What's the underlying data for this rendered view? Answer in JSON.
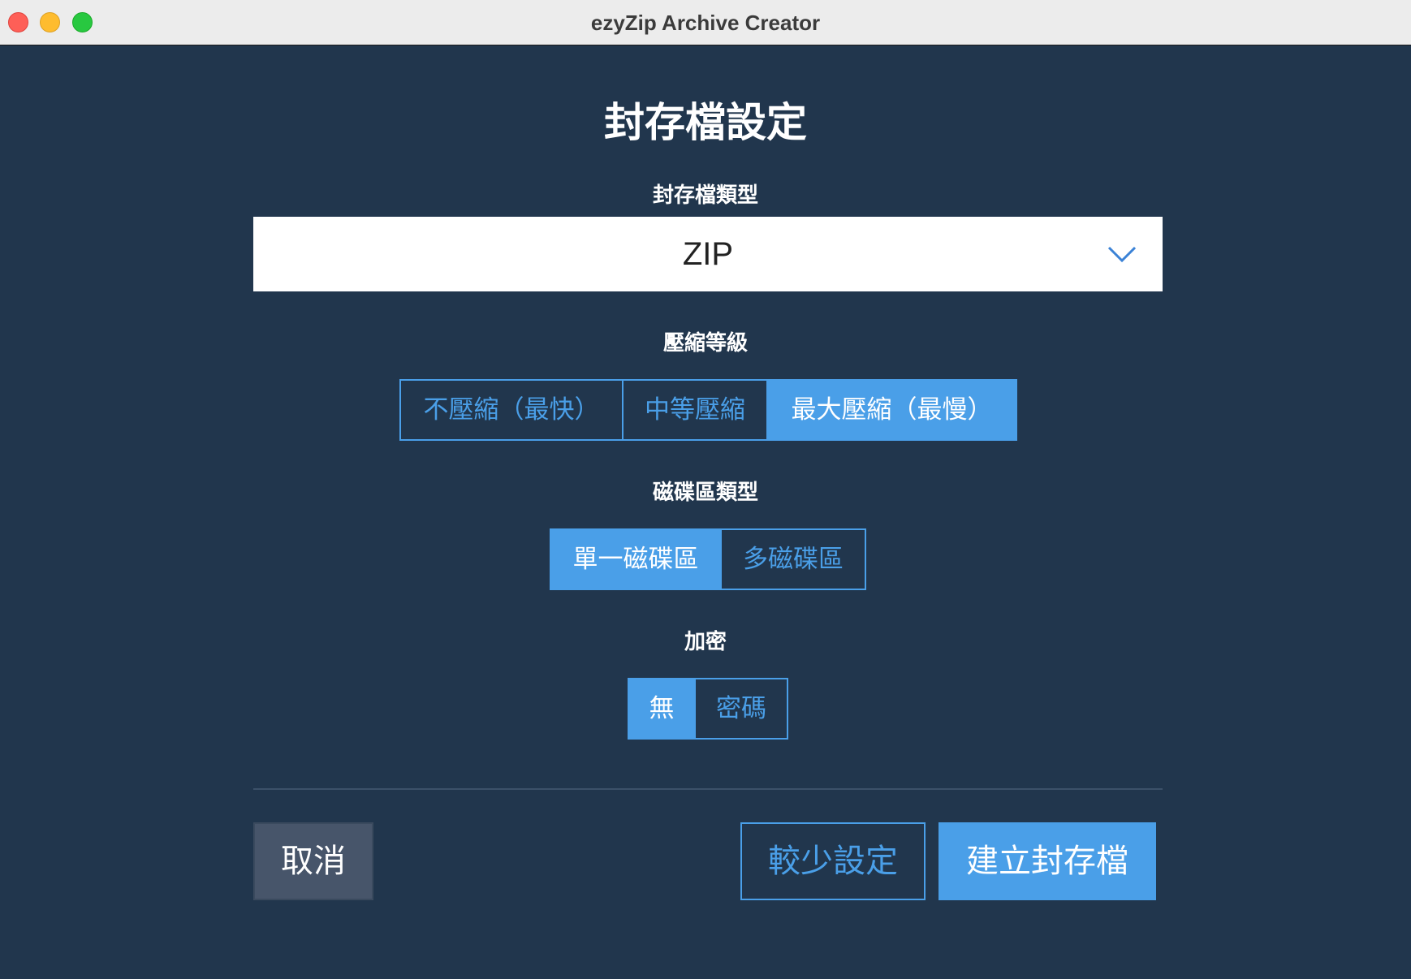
{
  "window": {
    "title": "ezyZip Archive Creator"
  },
  "heading": "封存檔設定",
  "archive_type": {
    "label": "封存檔類型",
    "selected": "ZIP"
  },
  "compression": {
    "label": "壓縮等級",
    "options": [
      "不壓縮（最快）",
      "中等壓縮",
      "最大壓縮（最慢）"
    ],
    "selected_index": 2
  },
  "volume": {
    "label": "磁碟區類型",
    "options": [
      "單一磁碟區",
      "多磁碟區"
    ],
    "selected_index": 0
  },
  "encryption": {
    "label": "加密",
    "options": [
      "無",
      "密碼"
    ],
    "selected_index": 0
  },
  "buttons": {
    "cancel": "取消",
    "fewer_settings": "較少設定",
    "create": "建立封存檔"
  },
  "colors": {
    "background": "#21364d",
    "accent": "#4a9fe8",
    "cancel_bg": "#47556a"
  }
}
